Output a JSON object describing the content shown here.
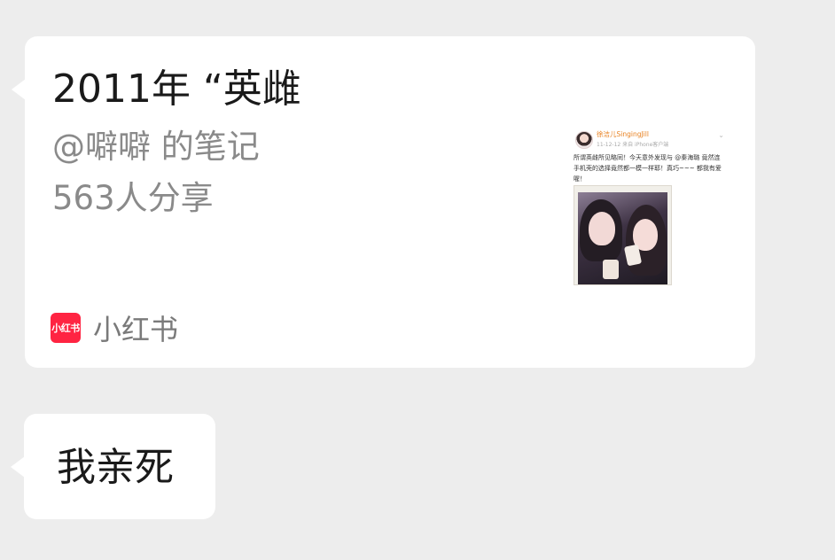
{
  "card": {
    "title": "2011年 “英雌",
    "author": "@噼噼 的笔记",
    "shares": "563人分享",
    "source_logo_text": "小红书",
    "source_name": "小红书",
    "thumbnail": {
      "user_name": "徐洁儿SingingJill",
      "meta": "11-12-12 来自 iPhone客户端",
      "post_text": "所谓英雌所见略同！今天意外发现与 @秦海璐 竟然连手机壳的选择竟然都一模一样耶！真巧~~~ 都我有爱喔！"
    }
  },
  "message": {
    "text": "我亲死"
  },
  "colors": {
    "background": "#ededed",
    "bubble": "#ffffff",
    "brand_red": "#ff2442"
  }
}
